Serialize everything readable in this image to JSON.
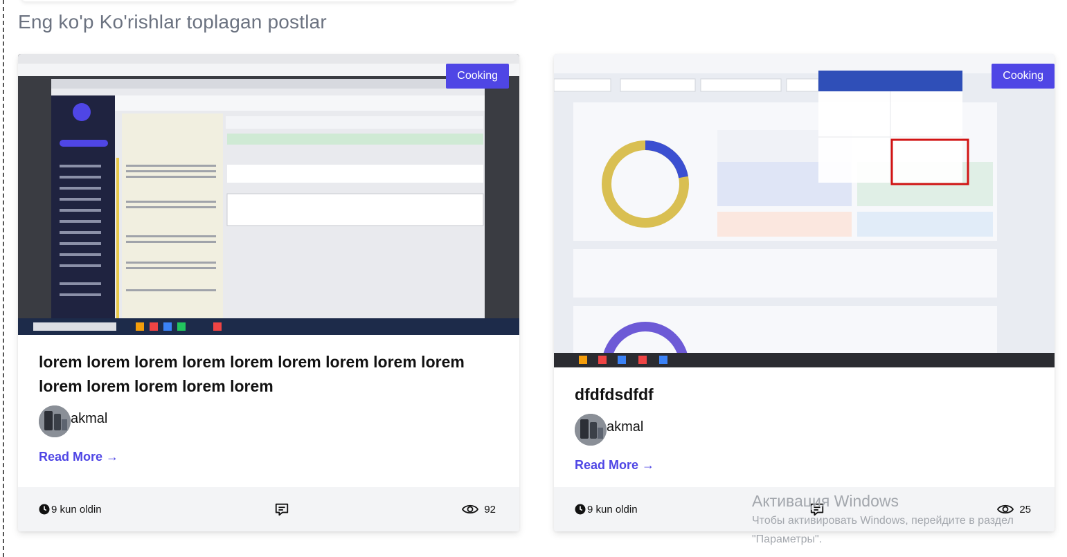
{
  "section": {
    "title": "Eng ko'p Ko'rishlar toplagan postlar"
  },
  "posts": [
    {
      "category": "Cooking",
      "title": "lorem lorem lorem lorem lorem lorem lorem lorem lorem lorem lorem lorem lorem lorem",
      "author": "akmal",
      "read_more": "Read More →",
      "time": "9 kun oldin",
      "views": "92"
    },
    {
      "category": "Cooking",
      "title": "dfdfdsdfdf",
      "author": "akmal",
      "read_more": "Read More →",
      "time": "9 kun oldin",
      "views": "25"
    }
  ],
  "watermark": {
    "title": "Активация Windows",
    "subtitle_line1": "Чтобы активировать Windows, перейдите в раздел",
    "subtitle_line2": "\"Параметры\"."
  },
  "colors": {
    "accent": "#4f46e5",
    "footer_bg": "#f3f4f6",
    "title_gray": "#6b7280"
  },
  "icons": [
    "clock-icon",
    "comment-icon",
    "eye-icon"
  ]
}
